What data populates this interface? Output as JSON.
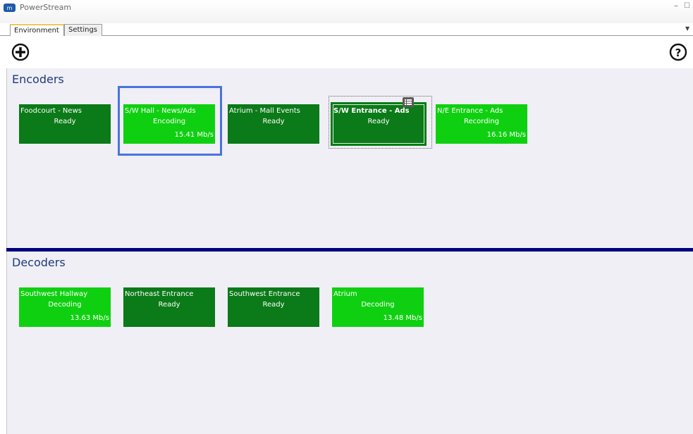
{
  "window": {
    "title": "PowerStream",
    "min_glyph": "–",
    "max_glyph": "☐"
  },
  "tabs": [
    {
      "label": "Environment"
    },
    {
      "label": "Settings"
    }
  ],
  "tab_menu_glyph": "▼",
  "toolbar": {
    "add_icon": "plus-circle-icon",
    "help_icon": "question-circle-icon"
  },
  "encoders": {
    "title": "Encoders",
    "tiles": [
      {
        "name": "Foodcourt - News",
        "status": "Ready",
        "rate": ""
      },
      {
        "name": "S/W Hall - News/Ads",
        "status": "Encoding",
        "rate": "15.41 Mb/s"
      },
      {
        "name": "Atrium - Mall Events",
        "status": "Ready",
        "rate": ""
      },
      {
        "name": "S/W Entrance - Ads",
        "status": "Ready",
        "rate": ""
      },
      {
        "name": "N/E Entrance - Ads",
        "status": "Recording",
        "rate": "16.16 Mb/s"
      }
    ]
  },
  "decoders": {
    "title": "Decoders",
    "tiles": [
      {
        "name": "Southwest Hallway",
        "status": "Decoding",
        "rate": "13.63 Mb/s"
      },
      {
        "name": "Northeast Entrance",
        "status": "Ready",
        "rate": ""
      },
      {
        "name": "Southwest Entrance",
        "status": "Ready",
        "rate": ""
      },
      {
        "name": "Atrium",
        "status": "Decoding",
        "rate": "13.48 Mb/s"
      }
    ]
  },
  "colors": {
    "active_tile": "#0fd010",
    "idle_tile": "#0b7a18",
    "divider": "#00007e",
    "selection": "#4b72de"
  }
}
